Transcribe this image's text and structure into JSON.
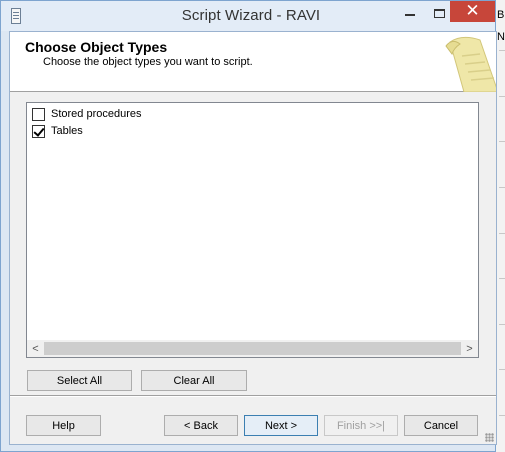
{
  "window": {
    "title": "Script Wizard - RAVI",
    "icons": [
      "app-icon",
      "minimize-icon",
      "maximize-icon",
      "close-icon"
    ],
    "close_glyph": "✕"
  },
  "header": {
    "title": "Choose Object Types",
    "subtitle": "Choose the object types you want to script.",
    "illustration": "scroll-icon"
  },
  "object_types": [
    {
      "label": "Stored procedures",
      "checked": false
    },
    {
      "label": "Tables",
      "checked": true
    }
  ],
  "list_buttons": {
    "select_all": "Select All",
    "clear_all": "Clear All"
  },
  "nav_buttons": {
    "help": "Help",
    "back": "< Back",
    "next": "Next >",
    "finish": "Finish >>|",
    "cancel": "Cancel"
  },
  "scrollbar_glyphs": {
    "left": "<",
    "right": ">"
  },
  "background_window": {
    "fragments": [
      "B",
      "N"
    ]
  },
  "colors": {
    "close_button": "#c7463a",
    "title_bar": "#e3ecf7",
    "primary_button_border": "#3c7fb1"
  }
}
